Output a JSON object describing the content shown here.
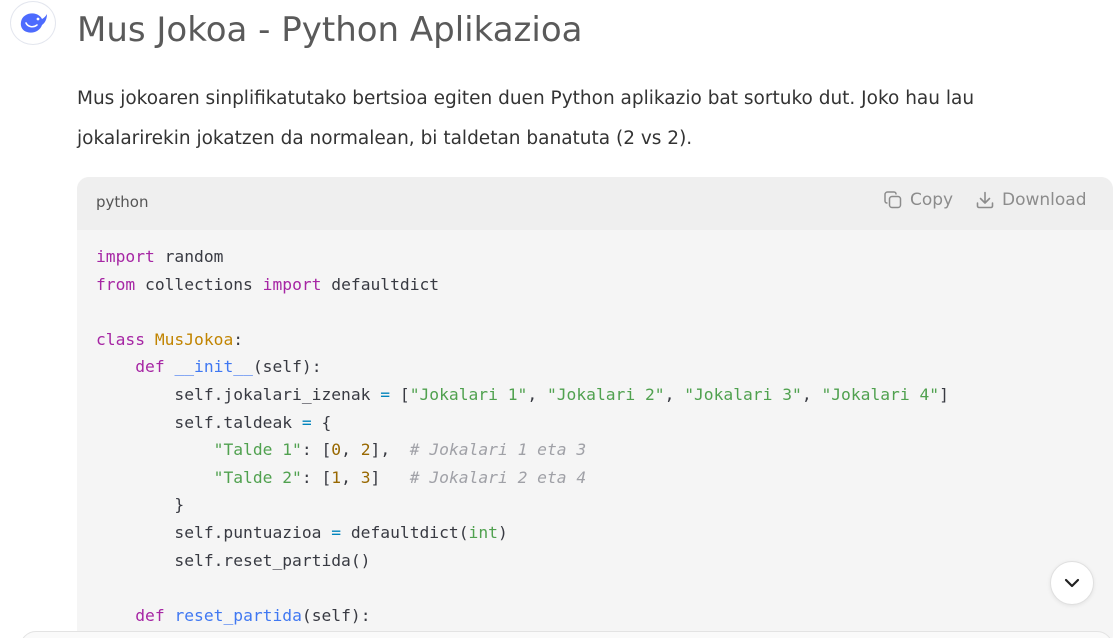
{
  "message": {
    "title": "Mus Jokoa - Python Aplikazioa",
    "intro": "Mus jokoaren sinplifikatutako bertsioa egiten duen Python aplikazio bat sortuko dut. Joko hau lau jokalarirekin jokatzen da normalean, bi taldetan banatuta (2 vs 2)."
  },
  "codeblock": {
    "language": "python",
    "copy_label": "Copy",
    "download_label": "Download",
    "lines": [
      [
        {
          "t": "kw",
          "s": "import"
        },
        {
          "t": "",
          "s": " random"
        }
      ],
      [
        {
          "t": "kw",
          "s": "from"
        },
        {
          "t": "",
          "s": " collections "
        },
        {
          "t": "kw",
          "s": "import"
        },
        {
          "t": "",
          "s": " defaultdict"
        }
      ],
      [],
      [
        {
          "t": "kw",
          "s": "class"
        },
        {
          "t": "",
          "s": " "
        },
        {
          "t": "cls",
          "s": "MusJokoa"
        },
        {
          "t": "",
          "s": ":"
        }
      ],
      [
        {
          "t": "",
          "s": "    "
        },
        {
          "t": "kw",
          "s": "def"
        },
        {
          "t": "",
          "s": " "
        },
        {
          "t": "fn",
          "s": "__init__"
        },
        {
          "t": "",
          "s": "(self):"
        }
      ],
      [
        {
          "t": "",
          "s": "        self.jokalari_izenak "
        },
        {
          "t": "bi",
          "s": "="
        },
        {
          "t": "",
          "s": " ["
        },
        {
          "t": "str",
          "s": "\"Jokalari 1\""
        },
        {
          "t": "",
          "s": ", "
        },
        {
          "t": "str",
          "s": "\"Jokalari 2\""
        },
        {
          "t": "",
          "s": ", "
        },
        {
          "t": "str",
          "s": "\"Jokalari 3\""
        },
        {
          "t": "",
          "s": ", "
        },
        {
          "t": "str",
          "s": "\"Jokalari 4\""
        },
        {
          "t": "",
          "s": "]"
        }
      ],
      [
        {
          "t": "",
          "s": "        self.taldeak "
        },
        {
          "t": "bi",
          "s": "="
        },
        {
          "t": "",
          "s": " {"
        }
      ],
      [
        {
          "t": "",
          "s": "            "
        },
        {
          "t": "str",
          "s": "\"Talde 1\""
        },
        {
          "t": "",
          "s": ": ["
        },
        {
          "t": "num",
          "s": "0"
        },
        {
          "t": "",
          "s": ", "
        },
        {
          "t": "num",
          "s": "2"
        },
        {
          "t": "",
          "s": "],  "
        },
        {
          "t": "cm",
          "s": "# Jokalari 1 eta 3"
        }
      ],
      [
        {
          "t": "",
          "s": "            "
        },
        {
          "t": "str",
          "s": "\"Talde 2\""
        },
        {
          "t": "",
          "s": ": ["
        },
        {
          "t": "num",
          "s": "1"
        },
        {
          "t": "",
          "s": ", "
        },
        {
          "t": "num",
          "s": "3"
        },
        {
          "t": "",
          "s": "]   "
        },
        {
          "t": "cm",
          "s": "# Jokalari 2 eta 4"
        }
      ],
      [
        {
          "t": "",
          "s": "        }"
        }
      ],
      [
        {
          "t": "",
          "s": "        self.puntuazioa "
        },
        {
          "t": "bi",
          "s": "="
        },
        {
          "t": "",
          "s": " defaultdict("
        },
        {
          "t": "bt",
          "s": "int"
        },
        {
          "t": "",
          "s": ")"
        }
      ],
      [
        {
          "t": "",
          "s": "        self.reset_partida()"
        }
      ],
      [],
      [
        {
          "t": "",
          "s": "    "
        },
        {
          "t": "kw",
          "s": "def"
        },
        {
          "t": "",
          "s": " "
        },
        {
          "t": "fn",
          "s": "reset_partida"
        },
        {
          "t": "",
          "s": "(self):"
        }
      ]
    ]
  },
  "icons": {
    "avatar": "deepseek-whale-icon",
    "copy": "copy-icon",
    "download": "download-icon",
    "scroll": "chevron-down-icon"
  },
  "colors": {
    "keyword": "#a626a4",
    "class_name": "#c18401",
    "function_name": "#4078f2",
    "string": "#50a14f",
    "number": "#986801",
    "comment": "#a0a1a7",
    "avatar_accent": "#4d6bfe"
  }
}
